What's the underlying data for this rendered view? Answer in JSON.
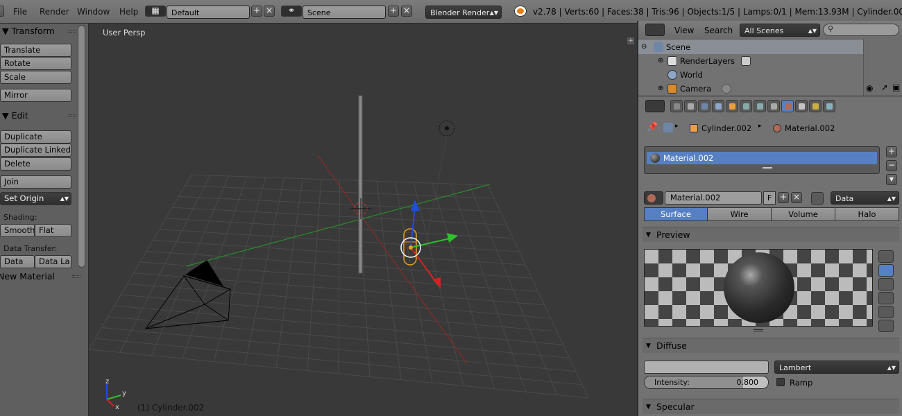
{
  "menu": {
    "file": "File",
    "render": "Render",
    "window": "Window",
    "help": "Help"
  },
  "header": {
    "layout": "Default",
    "scene": "Scene",
    "engine": "Blender Render",
    "stats": "v2.78 | Verts:60 | Faces:38 | Tris:96 | Objects:1/5 | Lamps:0/1 | Mem:13.93M | Cylinder.002"
  },
  "toolshelf": {
    "transform_title": "Transform",
    "translate": "Translate",
    "rotate": "Rotate",
    "scale": "Scale",
    "mirror": "Mirror",
    "edit_title": "Edit",
    "duplicate": "Duplicate",
    "duplicate_linked": "Duplicate Linked",
    "delete": "Delete",
    "join": "Join",
    "set_origin": "Set Origin",
    "shading_label": "Shading:",
    "smooth": "Smooth",
    "flat": "Flat",
    "data_transfer_label": "Data Transfer:",
    "data": "Data",
    "data_layout": "Data La",
    "new_material": "New Material"
  },
  "viewport": {
    "view_name": "User Persp",
    "active_object": "(1) Cylinder.002",
    "axis_x": "x",
    "axis_y": "y",
    "axis_z": "z"
  },
  "outliner": {
    "view": "View",
    "search": "Search",
    "filter": "All Scenes",
    "rows": [
      {
        "name": "Scene"
      },
      {
        "name": "RenderLayers"
      },
      {
        "name": "World"
      },
      {
        "name": "Camera"
      }
    ]
  },
  "properties": {
    "object_name": "Cylinder.002",
    "material_name": "Material.002",
    "slot_name": "Material.002",
    "fake_user": "F",
    "link_mode": "Data",
    "tabs": [
      "Surface",
      "Wire",
      "Volume",
      "Halo"
    ],
    "preview_title": "Preview",
    "diffuse_title": "Diffuse",
    "diffuse_shader": "Lambert",
    "intensity_label": "Intensity:",
    "intensity_value": "0.800",
    "intensity_fraction": 0.8,
    "ramp_label": "Ramp",
    "specular_title": "Specular"
  }
}
